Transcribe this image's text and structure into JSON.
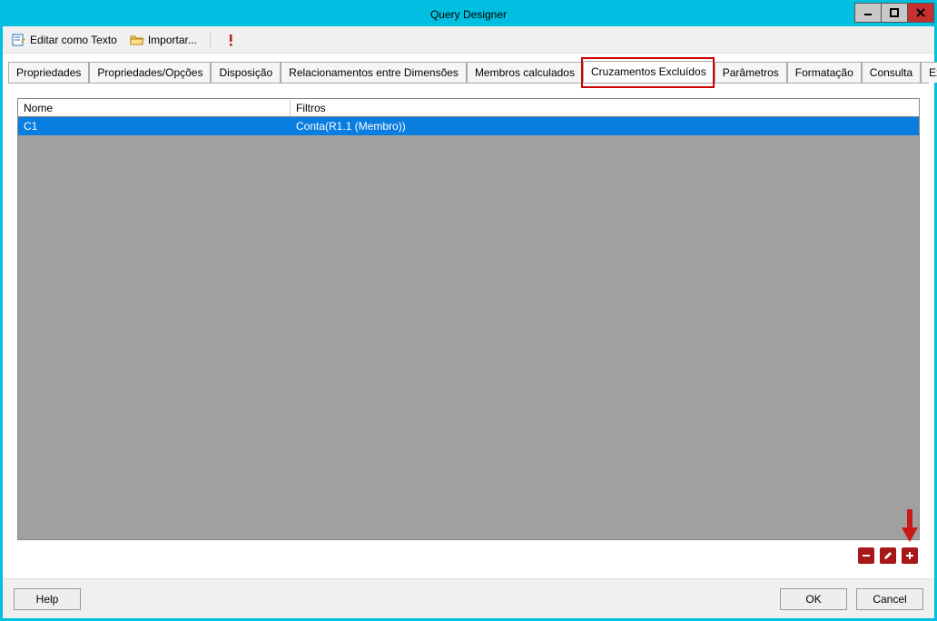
{
  "window": {
    "title": "Query Designer"
  },
  "toolbar": {
    "edit_text": "Editar como Texto",
    "import": "Importar..."
  },
  "tabs": [
    {
      "label": "Propriedades"
    },
    {
      "label": "Propriedades/Opções"
    },
    {
      "label": "Disposição"
    },
    {
      "label": "Relacionamentos entre Dimensões"
    },
    {
      "label": "Membros calculados"
    },
    {
      "label": "Cruzamentos Excluídos",
      "active": true
    },
    {
      "label": "Parâmetros"
    },
    {
      "label": "Formatação"
    },
    {
      "label": "Consulta"
    },
    {
      "label": "Execução"
    }
  ],
  "grid": {
    "columns": {
      "nome": "Nome",
      "filtros": "Filtros"
    },
    "rows": [
      {
        "nome": "C1",
        "filtros": "Conta(R1.1 (Membro))",
        "selected": true
      }
    ]
  },
  "actions": {
    "remove": "−",
    "edit": "✎",
    "add": "+"
  },
  "footer": {
    "help": "Help",
    "ok": "OK",
    "cancel": "Cancel"
  }
}
